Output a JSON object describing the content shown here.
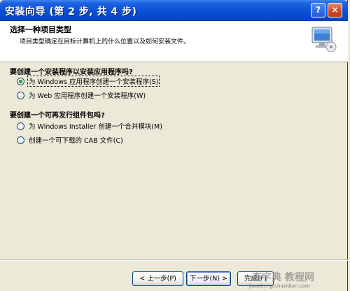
{
  "window": {
    "title": "安装向导 (第 2 步, 共 4 步)",
    "help_glyph": "?",
    "close_glyph": "×"
  },
  "header": {
    "title": "选择一种项目类型",
    "description": "项目类型确定在目标计算机上的什么位置以及如何安装文件。"
  },
  "groups": [
    {
      "question": "要创建一个安装程序以安装应用程序吗?",
      "options": [
        {
          "label": "为 Windows 应用程序创建一个安装程序(S)",
          "checked": true
        },
        {
          "label": "为 Web 应用程序创建一个安装程序(W)",
          "checked": false
        }
      ]
    },
    {
      "question": "要创建一个可再发行组件包吗?",
      "options": [
        {
          "label": "为 Windows Installer 创建一个合并模块(M)",
          "checked": false
        },
        {
          "label": "创建一个可下载的 CAB 文件(C)",
          "checked": false
        }
      ]
    }
  ],
  "buttons": {
    "back": "< 上一步(P)",
    "next": "下一步(N) >",
    "finish": "完成(F)"
  },
  "watermark": {
    "top": "查字典 教程网",
    "bottom": "jiaocheng.chazidian.com"
  },
  "colors": {
    "titlebar": "#0a4fd6",
    "dialog_bg": "#ece9d8",
    "header_bg": "#ffffff",
    "radio_dot": "#21a121"
  }
}
